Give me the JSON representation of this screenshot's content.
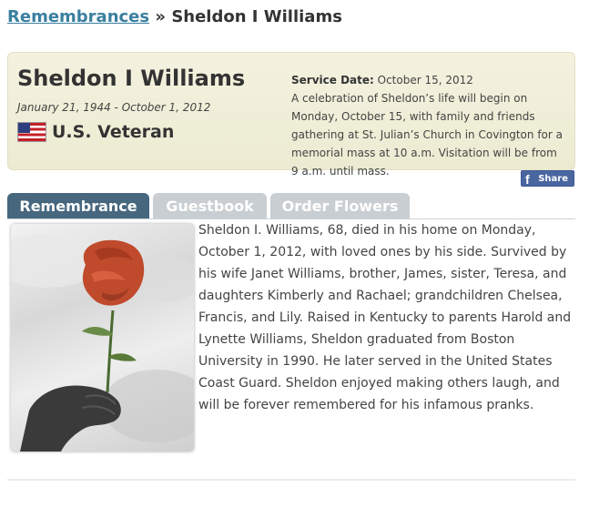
{
  "breadcrumb": {
    "parent_link": "Remembrances",
    "separator": "»",
    "current": "Sheldon I Williams"
  },
  "person": {
    "name": "Sheldon I Williams",
    "dates": "January 21, 1944 - October 1, 2012",
    "veteran_label": "U.S. Veteran",
    "flag_icon": "us-flag-icon"
  },
  "service": {
    "date_label": "Service Date:",
    "date_value": "October 15, 2012",
    "description": "A celebration of Sheldon’s life will begin on Monday, October 15, with family and friends gathering at St. Julian’s Church in Covington for a memorial mass at 10 a.m. Visitation will be from 9 a.m. until mass."
  },
  "share": {
    "icon": "facebook-icon",
    "icon_glyph": "f",
    "label": "Share"
  },
  "tabs": [
    {
      "label": "Remembrance",
      "active": true
    },
    {
      "label": "Guestbook",
      "active": false
    },
    {
      "label": "Order Flowers",
      "active": false
    }
  ],
  "remembrance": {
    "text": "Sheldon I. Williams, 68, died in his home on Monday, October 1, 2012, with loved ones by his side. Survived by his wife Janet Williams, brother, James, sister, Teresa, and daughters Kimberly and Rachael; grandchildren Chelsea, Francis, and Lily. Raised in Kentucky to parents Harold and Lynette Williams, Sheldon graduated from Boston University in 1990. He later served in the United States Coast Guard. Sheldon enjoyed making others laugh, and will be forever remembered for his infamous pranks."
  },
  "colors": {
    "link": "#3a7fa0",
    "active_tab": "#47677f",
    "inactive_tab": "#c9ced2",
    "header_bg": "#f4f2df",
    "facebook": "#4a66a0",
    "rose": "#c8502f"
  }
}
